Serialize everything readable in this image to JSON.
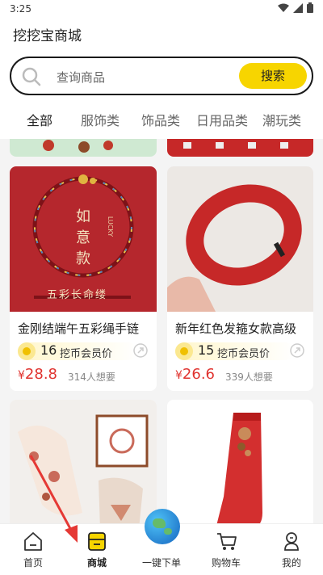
{
  "status_bar": {
    "time": "3:25",
    "icons": [
      "wifi-icon",
      "signal-icon",
      "battery-icon"
    ]
  },
  "app": {
    "title": "挖挖宝商城"
  },
  "search": {
    "placeholder": "查询商品",
    "button_label": "搜索"
  },
  "tabs": [
    {
      "label": "全部",
      "active": true
    },
    {
      "label": "服饰类",
      "active": false
    },
    {
      "label": "饰品类",
      "active": false
    },
    {
      "label": "日用品类",
      "active": false
    },
    {
      "label": "潮玩类",
      "active": false
    }
  ],
  "products": [
    {
      "name": "金刚结端午五彩绳手链",
      "coins": "16",
      "member_label": "挖币会员价",
      "currency": "¥",
      "price": "28.8",
      "wants": "314人想要"
    },
    {
      "name": "新年红色发箍女款高级",
      "coins": "15",
      "member_label": "挖币会员价",
      "currency": "¥",
      "price": "26.6",
      "wants": "339人想要"
    }
  ],
  "product_image_text": {
    "bracelet_title": "如 意 款",
    "bracelet_lucky": "LUCKY",
    "bracelet_caption": "五彩长命缕"
  },
  "bottom_nav": [
    {
      "label": "首页",
      "icon": "home-icon"
    },
    {
      "label": "商城",
      "icon": "store-icon",
      "active": true
    },
    {
      "label": "一键下单",
      "icon": "globe-icon"
    },
    {
      "label": "购物车",
      "icon": "cart-icon"
    },
    {
      "label": "我的",
      "icon": "profile-icon"
    }
  ],
  "colors": {
    "accent": "#f7d500",
    "price": "#e0332f",
    "annotation_arrow": "#e53935"
  }
}
